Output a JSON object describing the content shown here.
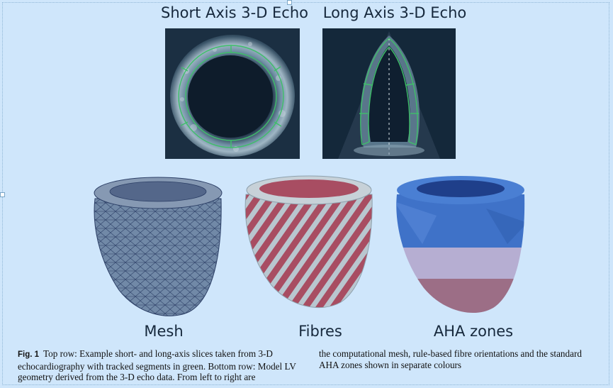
{
  "labels": {
    "short_axis": "Short Axis 3-D Echo",
    "long_axis": "Long Axis 3-D Echo",
    "mesh": "Mesh",
    "fibres": "Fibres",
    "aha": "AHA zones"
  },
  "caption": {
    "fig": "Fig. 1",
    "left_text": "Top row: Example short- and long-axis slices taken from 3-D echocardiography with tracked segments in green. Bottom row: Model LV geometry derived from the 3-D echo data. From left to right are",
    "right_text": "the computational mesh, rule-based fibre orientations and the standard AHA zones shown in separate colours"
  },
  "colors": {
    "background": "#cfe6fb",
    "segment_green": "#3fbf6a",
    "mesh_blue": "#6f86a6",
    "fibre_red": "#a84d62",
    "aha_blue": "#3f72c8",
    "aha_lavender": "#b6aed2",
    "aha_mauve": "#9c6e86"
  }
}
